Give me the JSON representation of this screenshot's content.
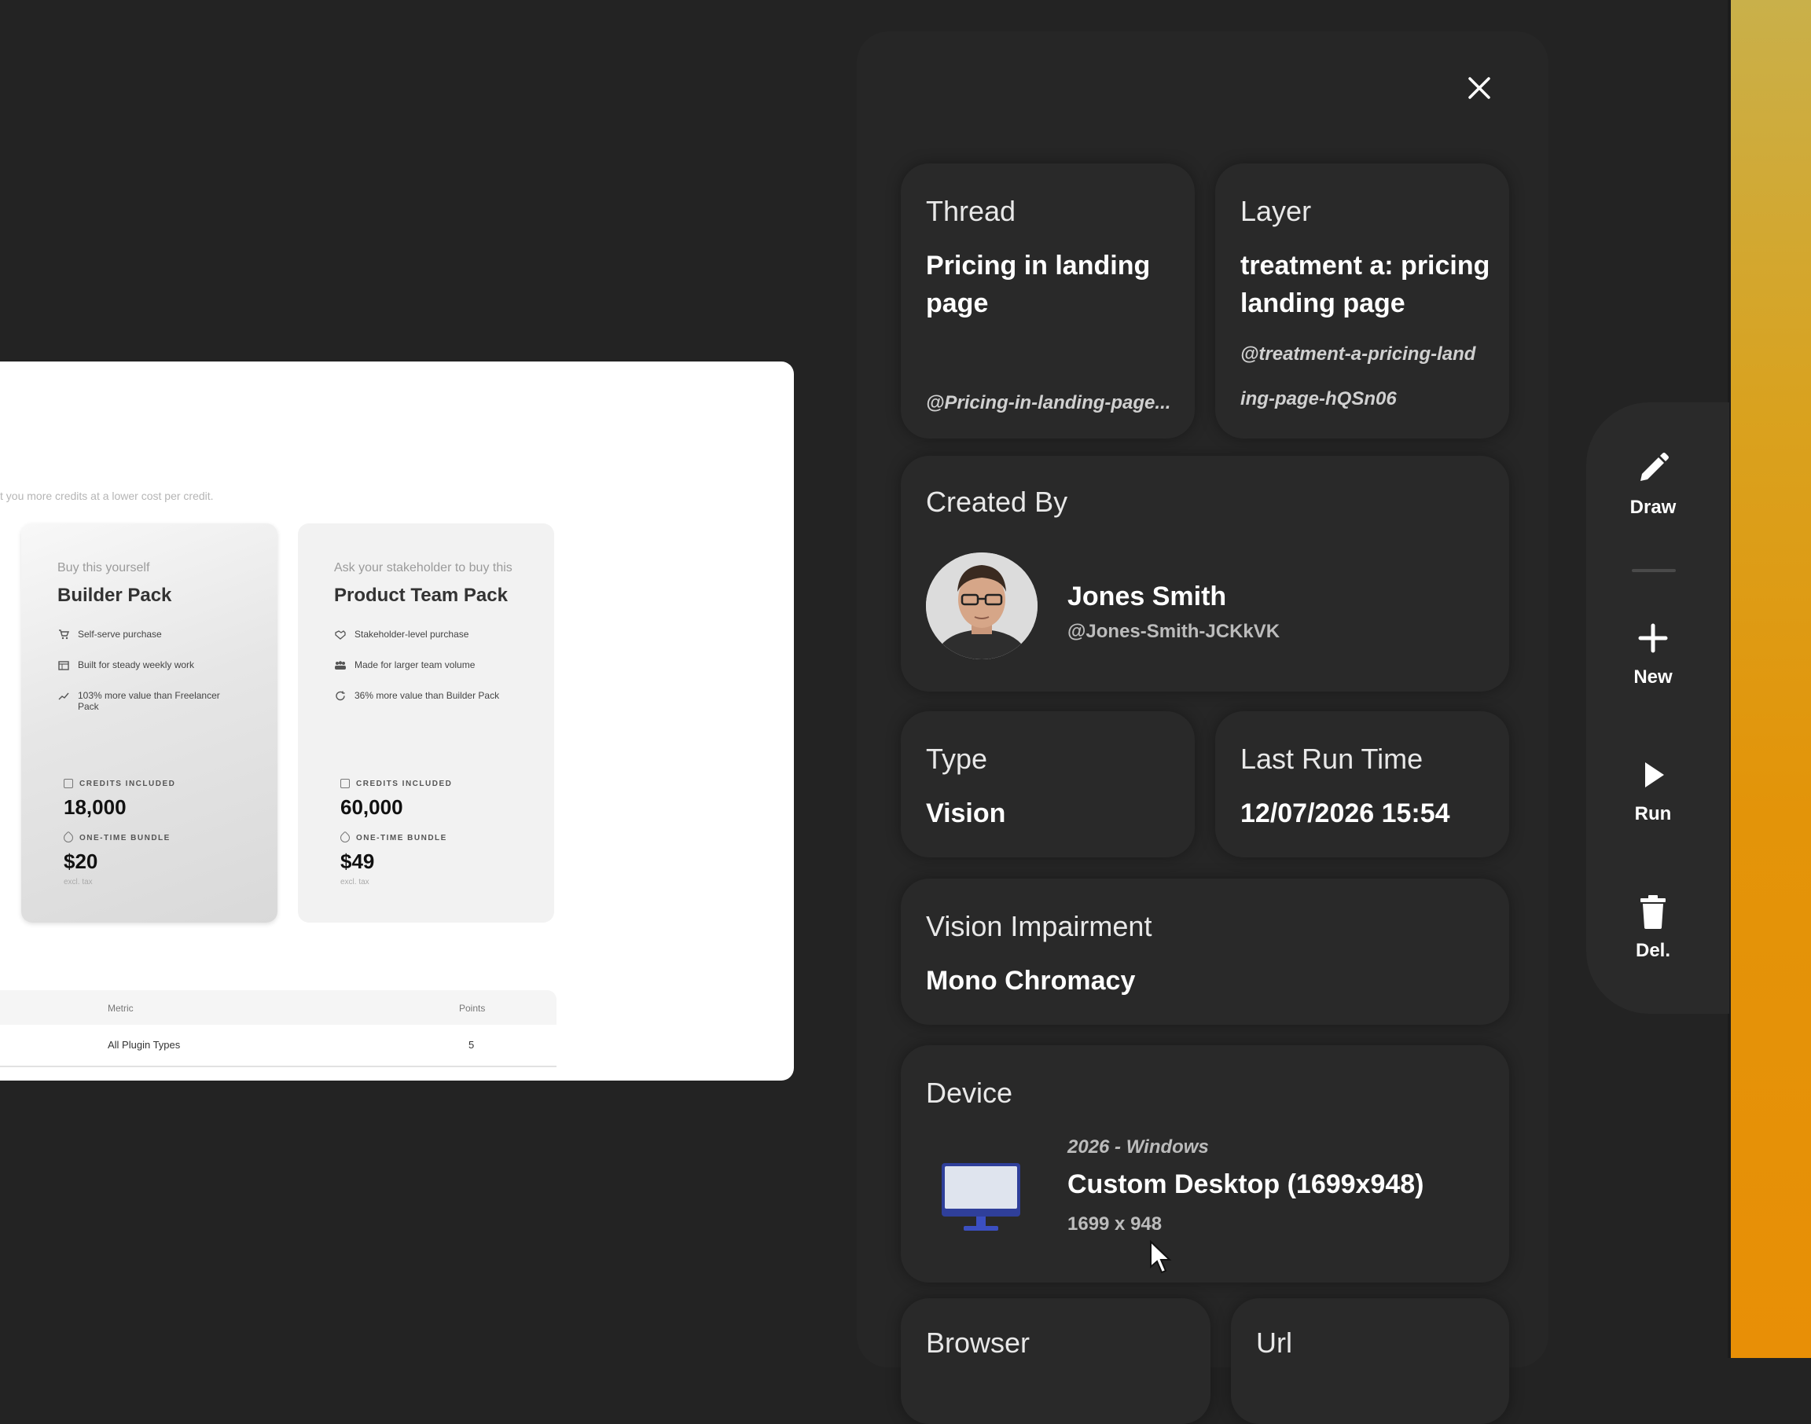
{
  "preview": {
    "tagline": "t you more credits at a lower cost per credit.",
    "cards": [
      {
        "subtitle": "Buy this yourself",
        "title": "Builder Pack",
        "features": [
          {
            "icon": "cart-icon",
            "text": "Self-serve purchase"
          },
          {
            "icon": "calendar-icon",
            "text": "Built for steady weekly work"
          },
          {
            "icon": "trend-up-icon",
            "text": "103% more value than Freelancer Pack"
          }
        ],
        "credits_label": "CREDITS INCLUDED",
        "credits": "18,000",
        "bundle_label": "ONE-TIME BUNDLE",
        "price": "$20",
        "tax_note": "excl. tax"
      },
      {
        "subtitle": "Ask your stakeholder to buy this",
        "title": "Product Team Pack",
        "features": [
          {
            "icon": "handshake-icon",
            "text": "Stakeholder-level purchase"
          },
          {
            "icon": "team-icon",
            "text": "Made for larger team volume"
          },
          {
            "icon": "refresh-icon",
            "text": "36% more value than Builder Pack"
          }
        ],
        "credits_label": "CREDITS INCLUDED",
        "credits": "60,000",
        "bundle_label": "ONE-TIME BUNDLE",
        "price": "$49",
        "tax_note": "excl. tax"
      }
    ],
    "table": {
      "headers": [
        "Metric",
        "Points"
      ],
      "rows": [
        [
          "All Plugin Types",
          "5"
        ]
      ]
    }
  },
  "details": {
    "thread": {
      "label": "Thread",
      "value": "Pricing in landing page",
      "handle": "@Pricing-in-landing-page..."
    },
    "layer": {
      "label": "Layer",
      "value": "treatment a: pricing landing page",
      "handle": "@treatment-a-pricing-landing-page-hQSn06"
    },
    "created_by": {
      "label": "Created By",
      "name": "Jones Smith",
      "handle": "@Jones-Smith-JCKkVK"
    },
    "type": {
      "label": "Type",
      "value": "Vision"
    },
    "last_run": {
      "label": "Last Run Time",
      "value": "12/07/2026 15:54"
    },
    "impairment": {
      "label": "Vision Impairment",
      "value": "Mono Chromacy"
    },
    "device": {
      "label": "Device",
      "os": "2026 - Windows",
      "name": "Custom Desktop (1699x948)",
      "size": "1699 x 948"
    },
    "browser": {
      "label": "Browser"
    },
    "url": {
      "label": "Url"
    }
  },
  "toolbar": {
    "draw": "Draw",
    "new": "New",
    "run": "Run",
    "delete": "Del."
  },
  "colors": {
    "background": "#232323",
    "panel": "#262626",
    "accent_strip": "#e39409"
  }
}
